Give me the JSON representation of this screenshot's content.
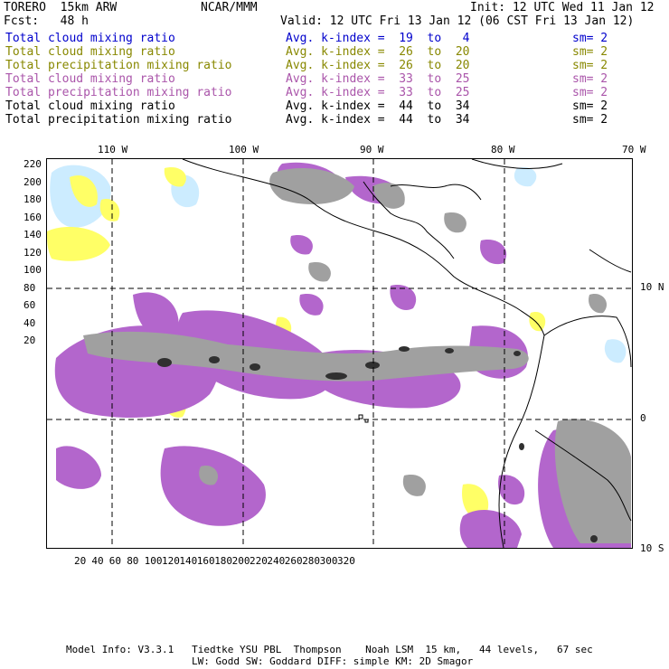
{
  "header": {
    "model": "TORERO  15km ARW",
    "org": "NCAR/MMM",
    "init": "Init: 12 UTC Wed 11 Jan 12",
    "fcst": "Fcst:   48 h",
    "valid": "Valid: 12 UTC Fri 13 Jan 12 (06 CST Fri 13 Jan 12)"
  },
  "legend": [
    {
      "field": "Total cloud mixing ratio",
      "kindex": "Avg. k-index =  19  to   4",
      "sm": "sm= 2",
      "color": "#0000cc"
    },
    {
      "field": "Total cloud mixing ratio",
      "kindex": "Avg. k-index =  26  to  20",
      "sm": "sm= 2",
      "color": "#888800"
    },
    {
      "field": "Total precipitation mixing ratio",
      "kindex": "Avg. k-index =  26  to  20",
      "sm": "sm= 2",
      "color": "#888800"
    },
    {
      "field": "Total cloud mixing ratio",
      "kindex": "Avg. k-index =  33  to  25",
      "sm": "sm= 2",
      "color": "#aa55aa"
    },
    {
      "field": "Total precipitation mixing ratio",
      "kindex": "Avg. k-index =  33  to  25",
      "sm": "sm= 2",
      "color": "#aa55aa"
    },
    {
      "field": "Total cloud mixing ratio",
      "kindex": "Avg. k-index =  44  to  34",
      "sm": "sm= 2",
      "color": "#000000"
    },
    {
      "field": "Total precipitation mixing ratio",
      "kindex": "Avg. k-index =  44  to  34",
      "sm": "sm= 2",
      "color": "#000000"
    }
  ],
  "axes": {
    "top_lon": [
      "110 W",
      "100 W",
      "90 W",
      "80 W",
      "70 W"
    ],
    "right_lat": [
      "10 N",
      "0",
      "10 S"
    ],
    "left_grid": [
      "220",
      "200",
      "180",
      "160",
      "140",
      "120",
      "100",
      "80",
      "60",
      "40",
      "20"
    ],
    "bottom_grid": [
      "20",
      "40",
      "60",
      "80",
      "100",
      "120",
      "140",
      "160",
      "180",
      "200",
      "220",
      "240",
      "260",
      "280",
      "300",
      "320"
    ]
  },
  "footer": {
    "line1": "Model Info: V3.3.1   Tiedtke YSU PBL  Thompson    Noah LSM  15 km,   44 levels,   67 sec",
    "line2": "LW: Godd SW: Goddard DIFF: simple KM: 2D Smagor"
  },
  "colors": {
    "blue": "#ccecff",
    "yellow": "#ffff66",
    "purple": "#b366cc",
    "gray": "#a0a0a0",
    "black": "#303030"
  }
}
